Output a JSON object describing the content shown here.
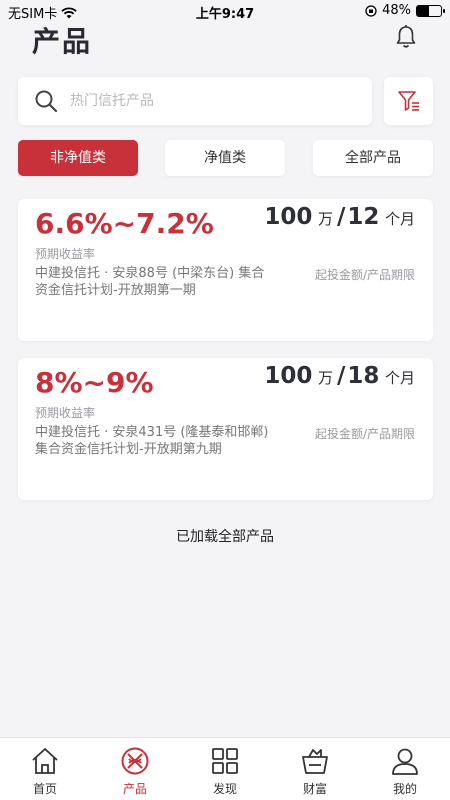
{
  "status_bar": {
    "carrier": "无SIM卡",
    "time": "上午9:47",
    "battery": "48%",
    "battery_level": 0.48
  },
  "header": {
    "title": "产品"
  },
  "search": {
    "placeholder": "热门信托产品"
  },
  "tabs": [
    {
      "label": "非净值类",
      "active": true
    },
    {
      "label": "净值类",
      "active": false
    },
    {
      "label": "全部产品",
      "active": false
    }
  ],
  "products": [
    {
      "rate": "6.6%~7.2%",
      "rate_label": "预期收益率",
      "name": "中建投信托 · 安泉88号 (中梁东台) 集合资金信托计划-开放期第一期",
      "min_amount": "100",
      "amount_unit": "万",
      "period": "12",
      "period_unit": "个月",
      "amount_label": "起投金额/产品期限"
    },
    {
      "rate": "8%~9%",
      "rate_label": "预期收益率",
      "name": "中建投信托 · 安泉431号 (隆基泰和邯郸) 集合资金信托计划-开放期第九期",
      "min_amount": "100",
      "amount_unit": "万",
      "period": "18",
      "period_unit": "个月",
      "amount_label": "起投金额/产品期限"
    }
  ],
  "footer_text": "已加载全部产品",
  "nav": [
    {
      "label": "首页",
      "icon": "home-icon",
      "active": false
    },
    {
      "label": "产品",
      "icon": "product-icon",
      "active": true
    },
    {
      "label": "发现",
      "icon": "discover-icon",
      "active": false
    },
    {
      "label": "财富",
      "icon": "wealth-icon",
      "active": false
    },
    {
      "label": "我的",
      "icon": "profile-icon",
      "active": false
    }
  ],
  "colors": {
    "accent": "#c8303a",
    "background": "#f4f4f6",
    "text_dark": "#2f2f3a"
  }
}
